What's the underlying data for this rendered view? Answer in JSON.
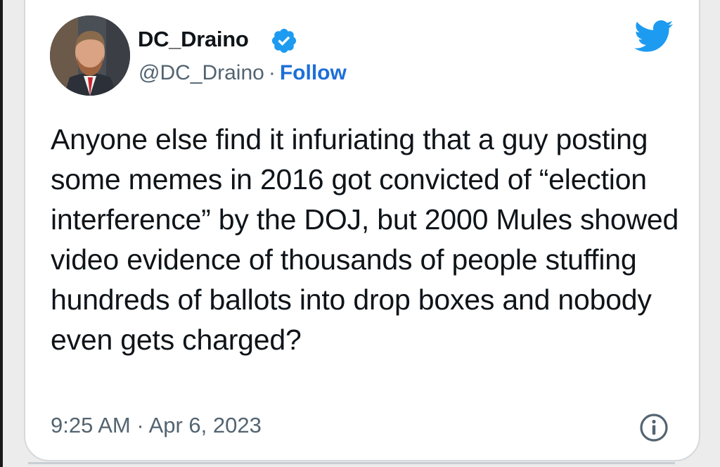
{
  "tweet": {
    "author": {
      "display_name": "DC_Draino",
      "handle": "@DC_Draino",
      "separator": "·",
      "follow_label": "Follow",
      "verified": true
    },
    "text": "Anyone else find it infuriating that a guy posting some memes in 2016 got convicted of “election interference” by the DOJ, but 2000 Mules showed video evidence of thousands of people stuffing hundreds of ballots into drop boxes and nobody even gets charged?",
    "timestamp": "9:25 AM · Apr 6, 2023"
  },
  "icons": {
    "verified": "verified-badge-icon",
    "brand": "twitter-bird-icon",
    "info": "info-icon"
  },
  "colors": {
    "accent": "#1d9bf0",
    "follow": "#1d6fd8",
    "text": "#0f1419",
    "secondary": "#536471"
  }
}
